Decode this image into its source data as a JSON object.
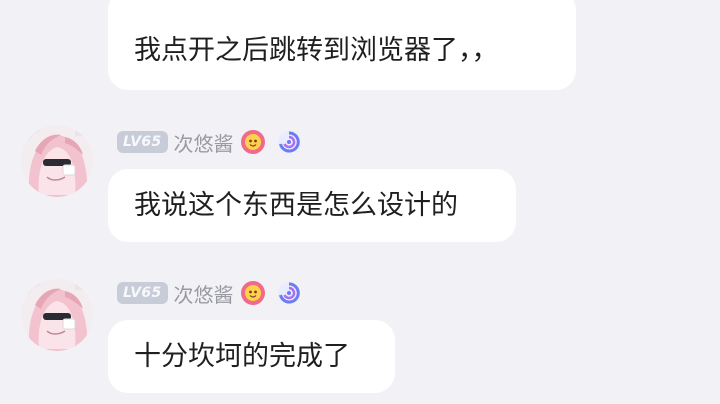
{
  "messages": [
    {
      "text": "我点开之后跳转到浏览器了，，"
    },
    {
      "sender": {
        "level": "LV65",
        "name": "次悠酱"
      },
      "text": "我说这个东西是怎么设计的"
    },
    {
      "sender": {
        "level": "LV65",
        "name": "次悠酱"
      },
      "text": "十分坎坷的完成了"
    }
  ],
  "colors": {
    "background": "#f2f2f6",
    "bubble": "#ffffff",
    "level_badge": "#c8ccd8",
    "username": "#9a9aa2"
  },
  "icons": {
    "badge_1": "flower-badge-icon",
    "badge_2": "swirl-badge-icon"
  }
}
